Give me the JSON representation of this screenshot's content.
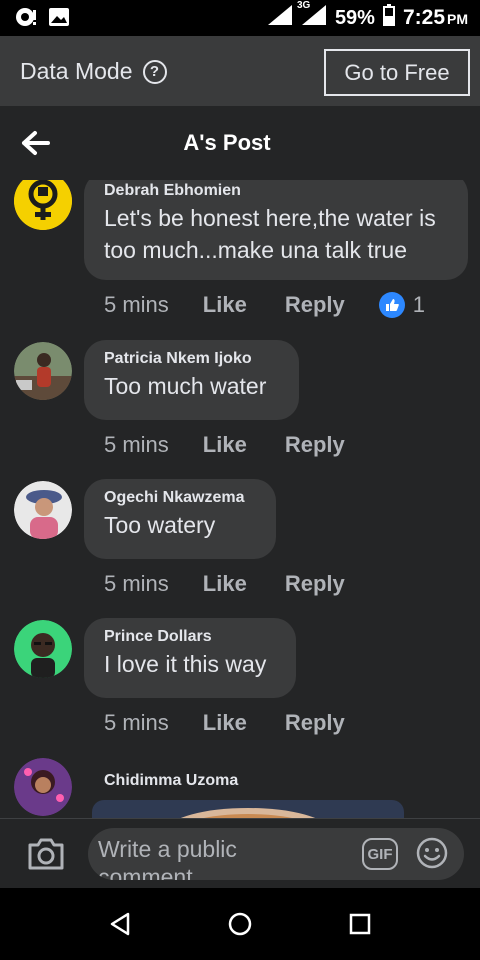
{
  "status": {
    "battery": "59%",
    "network": "3G",
    "time": "7:25",
    "ampm": "PM"
  },
  "data_mode": {
    "label": "Data Mode",
    "help_glyph": "?",
    "button": "Go to Free"
  },
  "header": {
    "title": "A's Post"
  },
  "comments": [
    {
      "name": "Debrah Ebhomien",
      "text_lines": [
        "Let's be honest here,the water is",
        "too much...make una talk true"
      ],
      "time": "5 mins",
      "like": "Like",
      "reply": "Reply",
      "reaction_count": "1"
    },
    {
      "name": "Patricia Nkem Ijoko",
      "text_lines": [
        "Too much water"
      ],
      "time": "5 mins",
      "like": "Like",
      "reply": "Reply"
    },
    {
      "name": "Ogechi Nkawzema",
      "text_lines": [
        "Too watery"
      ],
      "time": "5 mins",
      "like": "Like",
      "reply": "Reply"
    },
    {
      "name": "Prince Dollars",
      "text_lines": [
        "I love it this way"
      ],
      "time": "5 mins",
      "like": "Like",
      "reply": "Reply"
    },
    {
      "name": "Chidimma Uzoma"
    }
  ],
  "composer": {
    "placeholder": "Write a public comment",
    "gif": "GIF"
  },
  "colors": {
    "background": "#242526",
    "bubble": "#3a3b3c",
    "like_blue": "#2d88ff",
    "muted_text": "#b0b3b8"
  }
}
